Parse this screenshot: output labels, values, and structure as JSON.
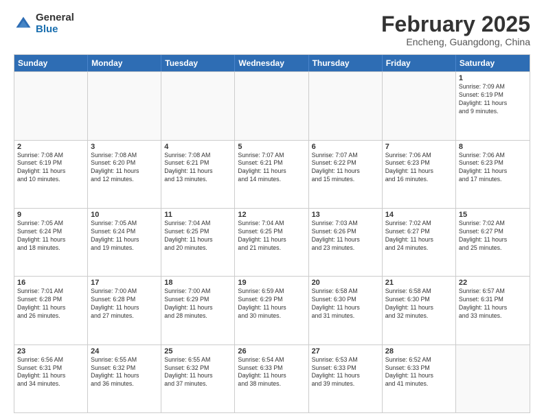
{
  "logo": {
    "general": "General",
    "blue": "Blue"
  },
  "header": {
    "month": "February 2025",
    "location": "Encheng, Guangdong, China"
  },
  "weekdays": [
    "Sunday",
    "Monday",
    "Tuesday",
    "Wednesday",
    "Thursday",
    "Friday",
    "Saturday"
  ],
  "rows": [
    [
      {
        "day": "",
        "info": ""
      },
      {
        "day": "",
        "info": ""
      },
      {
        "day": "",
        "info": ""
      },
      {
        "day": "",
        "info": ""
      },
      {
        "day": "",
        "info": ""
      },
      {
        "day": "",
        "info": ""
      },
      {
        "day": "1",
        "info": "Sunrise: 7:09 AM\nSunset: 6:19 PM\nDaylight: 11 hours\nand 9 minutes."
      }
    ],
    [
      {
        "day": "2",
        "info": "Sunrise: 7:08 AM\nSunset: 6:19 PM\nDaylight: 11 hours\nand 10 minutes."
      },
      {
        "day": "3",
        "info": "Sunrise: 7:08 AM\nSunset: 6:20 PM\nDaylight: 11 hours\nand 12 minutes."
      },
      {
        "day": "4",
        "info": "Sunrise: 7:08 AM\nSunset: 6:21 PM\nDaylight: 11 hours\nand 13 minutes."
      },
      {
        "day": "5",
        "info": "Sunrise: 7:07 AM\nSunset: 6:21 PM\nDaylight: 11 hours\nand 14 minutes."
      },
      {
        "day": "6",
        "info": "Sunrise: 7:07 AM\nSunset: 6:22 PM\nDaylight: 11 hours\nand 15 minutes."
      },
      {
        "day": "7",
        "info": "Sunrise: 7:06 AM\nSunset: 6:23 PM\nDaylight: 11 hours\nand 16 minutes."
      },
      {
        "day": "8",
        "info": "Sunrise: 7:06 AM\nSunset: 6:23 PM\nDaylight: 11 hours\nand 17 minutes."
      }
    ],
    [
      {
        "day": "9",
        "info": "Sunrise: 7:05 AM\nSunset: 6:24 PM\nDaylight: 11 hours\nand 18 minutes."
      },
      {
        "day": "10",
        "info": "Sunrise: 7:05 AM\nSunset: 6:24 PM\nDaylight: 11 hours\nand 19 minutes."
      },
      {
        "day": "11",
        "info": "Sunrise: 7:04 AM\nSunset: 6:25 PM\nDaylight: 11 hours\nand 20 minutes."
      },
      {
        "day": "12",
        "info": "Sunrise: 7:04 AM\nSunset: 6:25 PM\nDaylight: 11 hours\nand 21 minutes."
      },
      {
        "day": "13",
        "info": "Sunrise: 7:03 AM\nSunset: 6:26 PM\nDaylight: 11 hours\nand 23 minutes."
      },
      {
        "day": "14",
        "info": "Sunrise: 7:02 AM\nSunset: 6:27 PM\nDaylight: 11 hours\nand 24 minutes."
      },
      {
        "day": "15",
        "info": "Sunrise: 7:02 AM\nSunset: 6:27 PM\nDaylight: 11 hours\nand 25 minutes."
      }
    ],
    [
      {
        "day": "16",
        "info": "Sunrise: 7:01 AM\nSunset: 6:28 PM\nDaylight: 11 hours\nand 26 minutes."
      },
      {
        "day": "17",
        "info": "Sunrise: 7:00 AM\nSunset: 6:28 PM\nDaylight: 11 hours\nand 27 minutes."
      },
      {
        "day": "18",
        "info": "Sunrise: 7:00 AM\nSunset: 6:29 PM\nDaylight: 11 hours\nand 28 minutes."
      },
      {
        "day": "19",
        "info": "Sunrise: 6:59 AM\nSunset: 6:29 PM\nDaylight: 11 hours\nand 30 minutes."
      },
      {
        "day": "20",
        "info": "Sunrise: 6:58 AM\nSunset: 6:30 PM\nDaylight: 11 hours\nand 31 minutes."
      },
      {
        "day": "21",
        "info": "Sunrise: 6:58 AM\nSunset: 6:30 PM\nDaylight: 11 hours\nand 32 minutes."
      },
      {
        "day": "22",
        "info": "Sunrise: 6:57 AM\nSunset: 6:31 PM\nDaylight: 11 hours\nand 33 minutes."
      }
    ],
    [
      {
        "day": "23",
        "info": "Sunrise: 6:56 AM\nSunset: 6:31 PM\nDaylight: 11 hours\nand 34 minutes."
      },
      {
        "day": "24",
        "info": "Sunrise: 6:55 AM\nSunset: 6:32 PM\nDaylight: 11 hours\nand 36 minutes."
      },
      {
        "day": "25",
        "info": "Sunrise: 6:55 AM\nSunset: 6:32 PM\nDaylight: 11 hours\nand 37 minutes."
      },
      {
        "day": "26",
        "info": "Sunrise: 6:54 AM\nSunset: 6:33 PM\nDaylight: 11 hours\nand 38 minutes."
      },
      {
        "day": "27",
        "info": "Sunrise: 6:53 AM\nSunset: 6:33 PM\nDaylight: 11 hours\nand 39 minutes."
      },
      {
        "day": "28",
        "info": "Sunrise: 6:52 AM\nSunset: 6:33 PM\nDaylight: 11 hours\nand 41 minutes."
      },
      {
        "day": "",
        "info": ""
      }
    ]
  ]
}
